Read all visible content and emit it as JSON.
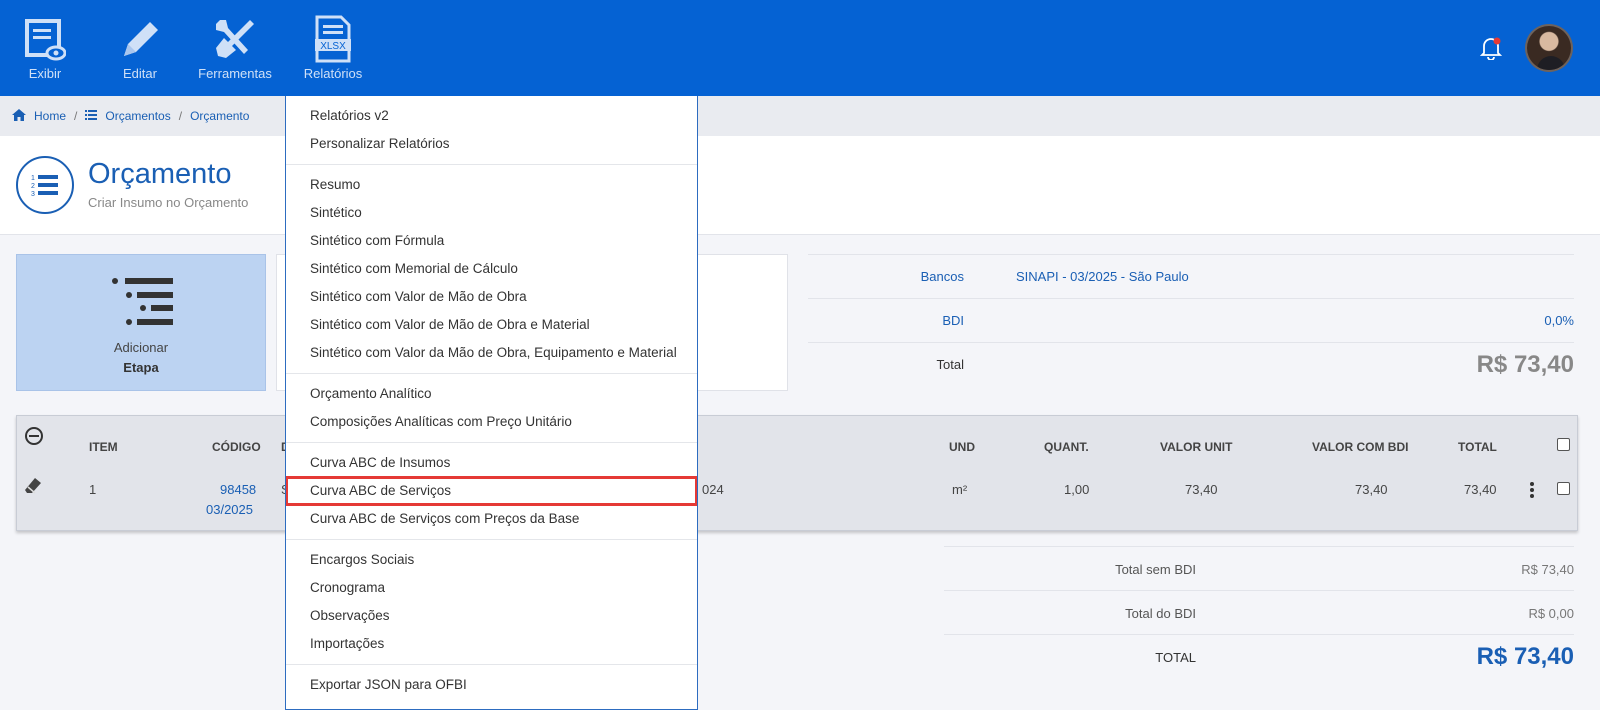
{
  "toolbar": {
    "items": [
      {
        "label": "Exibir",
        "icon": "view-icon"
      },
      {
        "label": "Editar",
        "icon": "pencil-icon"
      },
      {
        "label": "Ferramentas",
        "icon": "tools-icon"
      },
      {
        "label": "Relatórios",
        "icon": "xlsx-icon",
        "icon_text": "XLSX"
      }
    ]
  },
  "breadcrumb": {
    "home": "Home",
    "orcamentos": "Orçamentos",
    "orcamento": "Orçamento"
  },
  "page": {
    "title": "Orçamento",
    "subtitle": "Criar Insumo no Orçamento"
  },
  "add_card": {
    "line1": "Adicionar",
    "line2": "Etapa"
  },
  "info": {
    "bancos_label": "Bancos",
    "bancos_value": "SINAPI - 03/2025 - São Paulo",
    "bdi_label": "BDI",
    "bdi_value": "0,0%",
    "total_label": "Total",
    "total_value": "R$ 73,40"
  },
  "table": {
    "headers": {
      "item": "ITEM",
      "codigo": "CÓDIGO",
      "desc": "D",
      "und": "UND",
      "quant": "QUANT.",
      "valor_unit": "VALOR UNIT",
      "valor_bdi": "VALOR COM BDI",
      "total": "TOTAL"
    },
    "rows": [
      {
        "item": "1",
        "codigo": "98458",
        "data": "03/2025",
        "desc_start": "S",
        "desc_end": "024",
        "und": "m²",
        "quant": "1,00",
        "valor_unit": "73,40",
        "valor_bdi": "73,40",
        "total": "73,40"
      }
    ]
  },
  "totals": {
    "sem_bdi_label": "Total sem BDI",
    "sem_bdi_value": "R$ 73,40",
    "do_bdi_label": "Total do BDI",
    "do_bdi_value": "R$ 0,00",
    "total_label": "TOTAL",
    "total_value": "R$ 73,40"
  },
  "menu": {
    "groups": [
      [
        "Relatórios v2",
        "Personalizar Relatórios"
      ],
      [
        "Resumo",
        "Sintético",
        "Sintético com Fórmula",
        "Sintético com Memorial de Cálculo",
        "Sintético com Valor de Mão de Obra",
        "Sintético com Valor de Mão de Obra e Material",
        "Sintético com Valor da Mão de Obra, Equipamento e Material"
      ],
      [
        "Orçamento Analítico",
        "Composições Analíticas com Preço Unitário"
      ],
      [
        "Curva ABC de Insumos",
        "Curva ABC de Serviços",
        "Curva ABC de Serviços com Preços da Base"
      ],
      [
        "Encargos Sociais",
        "Cronograma",
        "Observações",
        "Importações"
      ],
      [
        "Exportar JSON para OFBI"
      ]
    ],
    "highlighted": "Curva ABC de Serviços"
  },
  "colors": {
    "topbar": "#0562d3",
    "accent": "#1a5fb4",
    "highlight": "#e53935"
  }
}
